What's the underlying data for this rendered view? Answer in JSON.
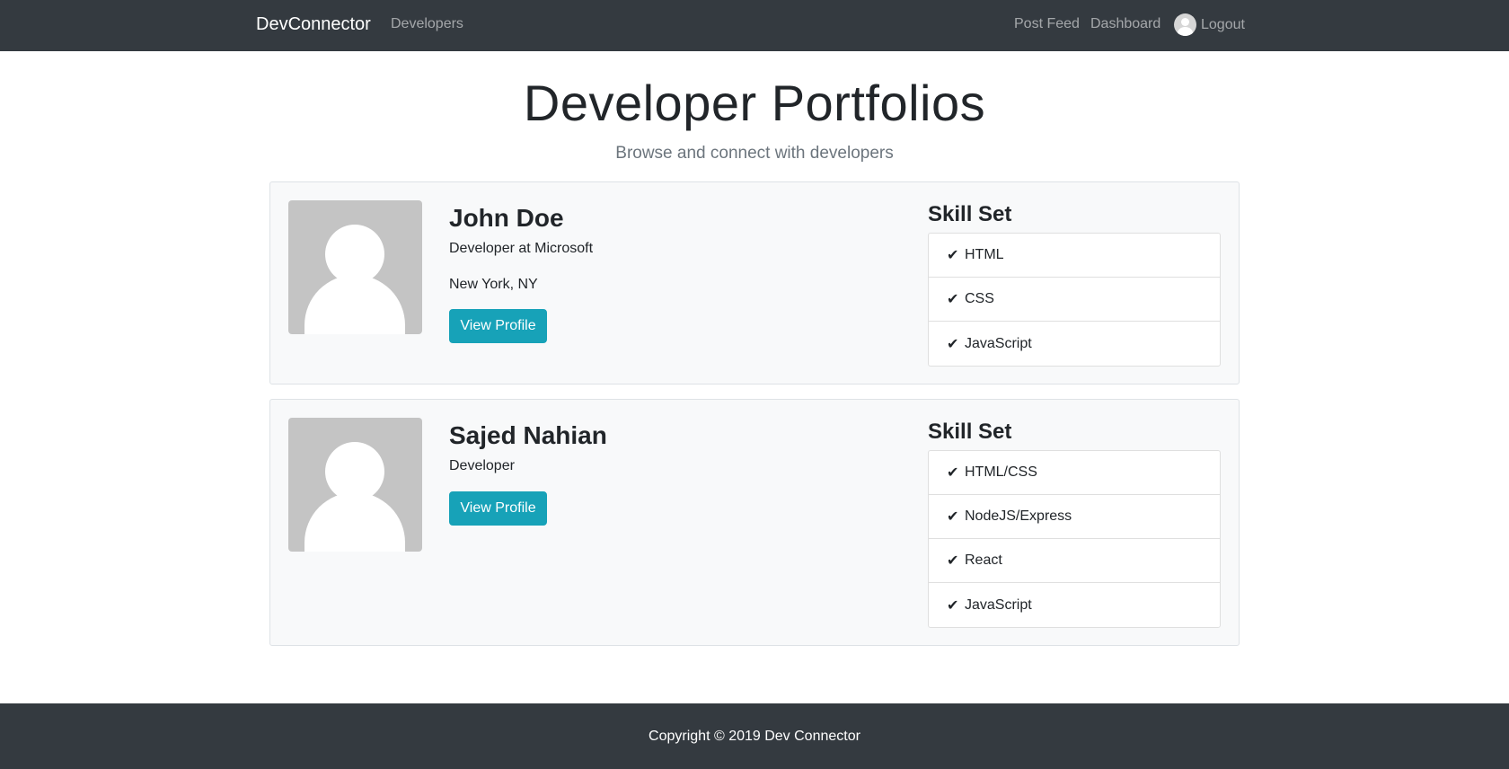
{
  "navbar": {
    "brand": "DevConnector",
    "developers": "Developers",
    "post_feed": "Post Feed",
    "dashboard": "Dashboard",
    "logout": "Logout"
  },
  "header": {
    "title": "Developer Portfolios",
    "subtitle": "Browse and connect with developers"
  },
  "profiles": [
    {
      "name": "John Doe",
      "role": "Developer at Microsoft",
      "location": "New York, NY",
      "button": "View Profile",
      "skill_title": "Skill Set",
      "skills": [
        "HTML",
        "CSS",
        "JavaScript"
      ]
    },
    {
      "name": "Sajed Nahian",
      "role": "Developer",
      "button": "View Profile",
      "skill_title": "Skill Set",
      "skills": [
        "HTML/CSS",
        "NodeJS/Express",
        "React",
        "JavaScript"
      ]
    }
  ],
  "icons": {
    "check": "✔"
  },
  "footer": {
    "copyright": "Copyright © 2019 Dev Connector"
  },
  "colors": {
    "navbar": "#343a40",
    "button": "#17a2b8",
    "card_bg": "#f8f9fa"
  }
}
